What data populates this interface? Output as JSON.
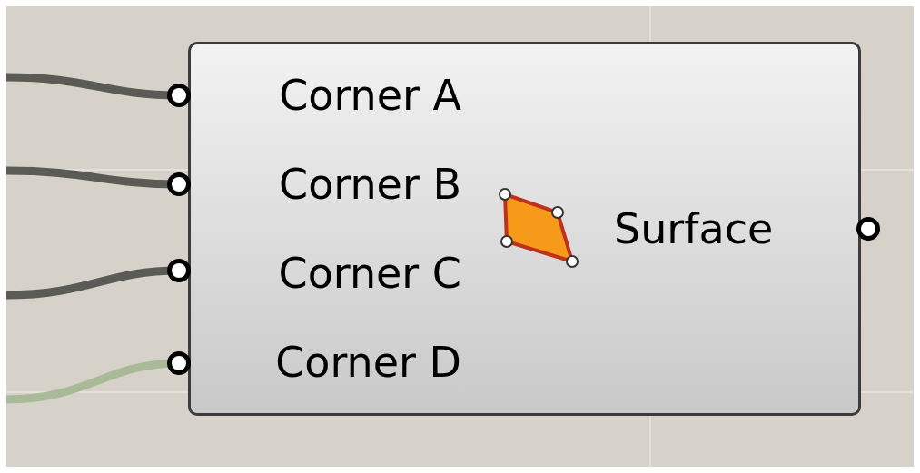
{
  "component": {
    "inputs": [
      {
        "label": "Corner A",
        "color": "#5b5b55"
      },
      {
        "label": "Corner B",
        "color": "#5b5b55"
      },
      {
        "label": "Corner C",
        "color": "#5b5b55"
      },
      {
        "label": "Corner D",
        "color": "#a9ba98"
      }
    ],
    "outputs": [
      {
        "label": "Surface"
      }
    ]
  }
}
